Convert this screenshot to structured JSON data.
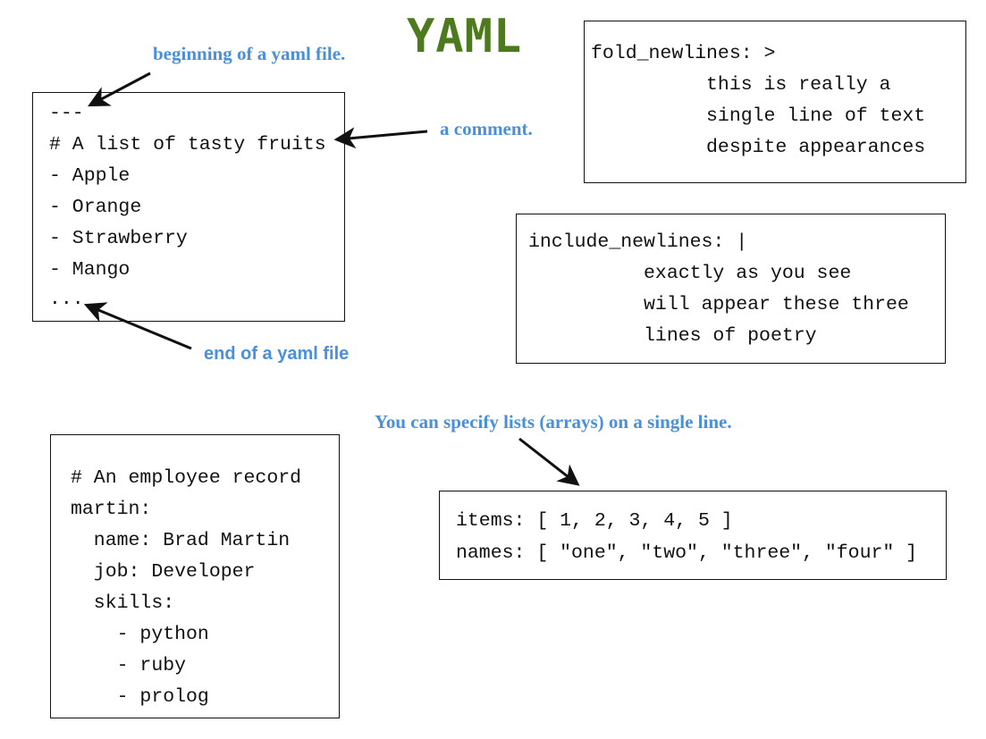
{
  "colors": {
    "title": "#4e7a1e",
    "annotation": "#4a90d9",
    "text": "#111111",
    "border": "#111111"
  },
  "title": "YAML",
  "annotations": {
    "beginning": "beginning of a yaml file.",
    "comment": "a comment.",
    "end": "end of a yaml file",
    "lists": "You can specify lists (arrays) on a single line."
  },
  "fruits_box": {
    "lines": [
      "---",
      "# A list of tasty fruits",
      "- Apple",
      "- Orange",
      "- Strawberry",
      "- Mango",
      "..."
    ]
  },
  "fold_box": {
    "lines": [
      "fold_newlines: >",
      "          this is really a",
      "          single line of text",
      "          despite appearances"
    ]
  },
  "include_box": {
    "lines": [
      "include_newlines: |",
      "          exactly as you see",
      "          will appear these three",
      "          lines of poetry"
    ]
  },
  "employee_box": {
    "lines": [
      "# An employee record",
      "martin:",
      "  name: Brad Martin",
      "  job: Developer",
      "  skills:",
      "    - python",
      "    - ruby",
      "    - prolog"
    ]
  },
  "items_box": {
    "lines": [
      "items: [ 1, 2, 3, 4, 5 ]",
      "names: [ \"one\", \"two\", \"three\", \"four\" ]"
    ]
  }
}
